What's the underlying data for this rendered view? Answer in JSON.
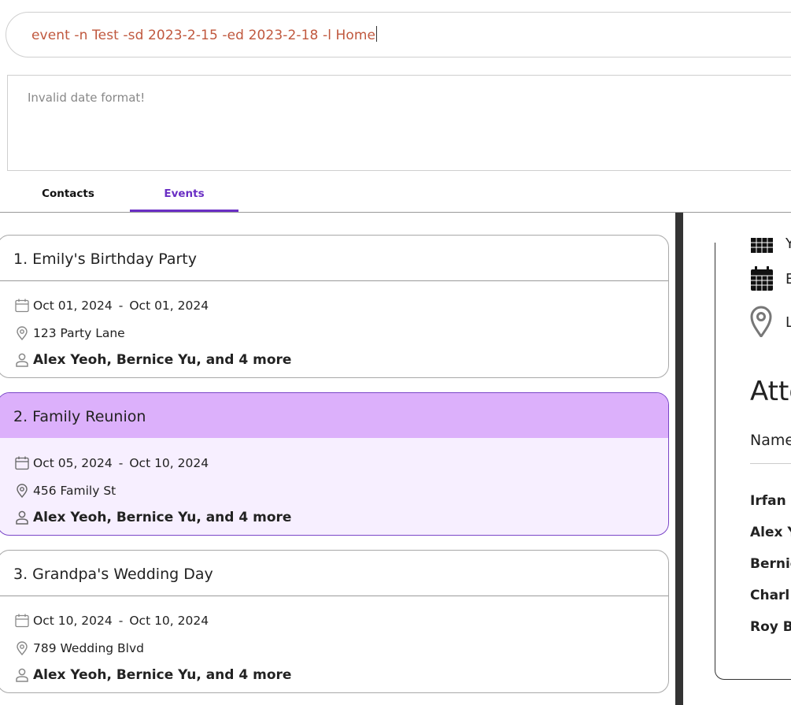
{
  "command": {
    "value": "event -n Test -sd 2023-2-15 -ed 2023-2-18 -l Home"
  },
  "result": {
    "text": "Invalid date format!"
  },
  "tabs": [
    {
      "label": "Contacts",
      "active": false
    },
    {
      "label": "Events",
      "active": true
    }
  ],
  "colors": {
    "accent": "#6a2fc4",
    "command_text": "#c0583e",
    "selected_header": "#dcb0fb",
    "selected_body": "#f7efff"
  },
  "events": [
    {
      "title": "1. Emily's Birthday Party",
      "start": "Oct 01, 2024",
      "sep": "-",
      "end": "Oct 01, 2024",
      "location": "123 Party Lane",
      "attendees": "Alex Yeoh, Bernice Yu, and 4 more",
      "selected": false
    },
    {
      "title": "2. Family Reunion",
      "start": "Oct 05, 2024",
      "sep": "-",
      "end": "Oct 10, 2024",
      "location": "456 Family St",
      "attendees": "Alex Yeoh, Bernice Yu, and 4 more",
      "selected": true
    },
    {
      "title": "3. Grandpa's Wedding Day",
      "start": "Oct 10, 2024",
      "sep": "-",
      "end": "Oct 10, 2024",
      "location": "789 Wedding Blvd",
      "attendees": "Alex Yeoh, Bernice Yu, and 4 more",
      "selected": false
    }
  ],
  "detail": {
    "rows": [
      {
        "icon": "calendar-icon",
        "letter": "Y"
      },
      {
        "icon": "calendar-icon",
        "letter": "E"
      },
      {
        "icon": "location-pin-icon",
        "letter": "L"
      }
    ],
    "attendees_title": "Atte",
    "name_header": "Name",
    "attendees": [
      "Irfan I",
      "Alex Y",
      "Bernic",
      "Charl",
      "Roy Ba"
    ]
  }
}
